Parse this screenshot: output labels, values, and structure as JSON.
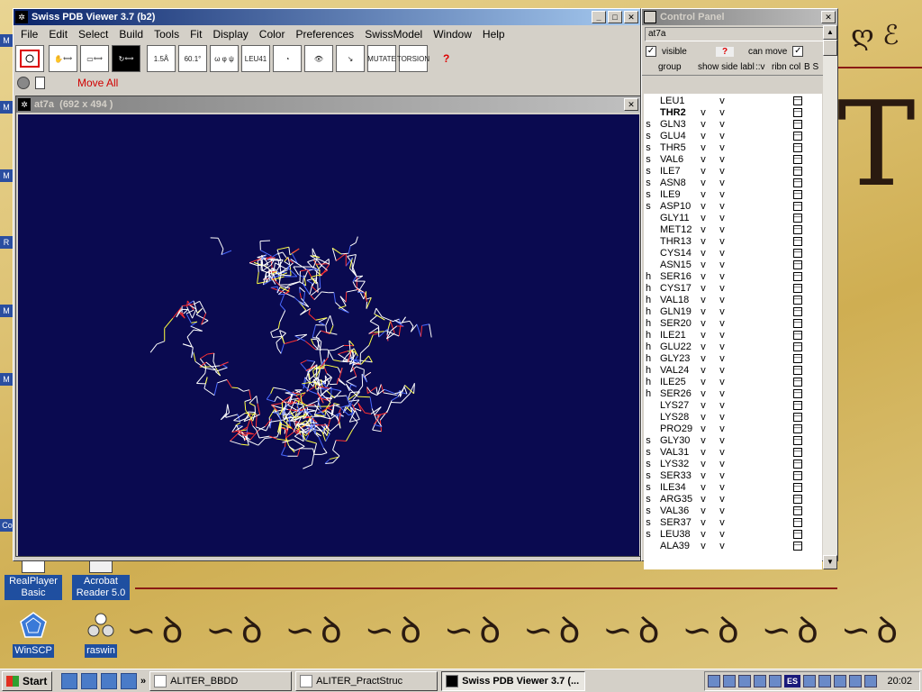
{
  "main_window": {
    "title": "Swiss PDB Viewer 3.7 (b2)",
    "menus": [
      "File",
      "Edit",
      "Select",
      "Build",
      "Tools",
      "Fit",
      "Display",
      "Color",
      "Preferences",
      "SwissModel",
      "Window",
      "Help"
    ],
    "toolbar_labels": {
      "distance": "1.5Å",
      "angle": "60.1°",
      "torsion": "ω φ ψ",
      "find": "LEU41",
      "mutate": "MUTATE",
      "torsion_tool": "TORSION"
    },
    "move_all": "Move All"
  },
  "structure_window": {
    "title": "at7a",
    "size": "(692 x 494 )"
  },
  "control_panel": {
    "title": "Control Panel",
    "field": "at7a",
    "visible_label": "visible",
    "can_move_label": "can move",
    "help": "?",
    "headers": [
      "group",
      "show side labl",
      "::v",
      "ribn col",
      "B S"
    ],
    "residues": [
      {
        "ss": "",
        "name": "LEU1",
        "show": "",
        "side": "v",
        "bold": false
      },
      {
        "ss": "",
        "name": "THR2",
        "show": "v",
        "side": "v",
        "bold": true
      },
      {
        "ss": "s",
        "name": "GLN3",
        "show": "v",
        "side": "v",
        "bold": false
      },
      {
        "ss": "s",
        "name": "GLU4",
        "show": "v",
        "side": "v",
        "bold": false
      },
      {
        "ss": "s",
        "name": "THR5",
        "show": "v",
        "side": "v",
        "bold": false
      },
      {
        "ss": "s",
        "name": "VAL6",
        "show": "v",
        "side": "v",
        "bold": false
      },
      {
        "ss": "s",
        "name": "ILE7",
        "show": "v",
        "side": "v",
        "bold": false
      },
      {
        "ss": "s",
        "name": "ASN8",
        "show": "v",
        "side": "v",
        "bold": false
      },
      {
        "ss": "s",
        "name": "ILE9",
        "show": "v",
        "side": "v",
        "bold": false
      },
      {
        "ss": "s",
        "name": "ASP10",
        "show": "v",
        "side": "v",
        "bold": false
      },
      {
        "ss": "",
        "name": "GLY11",
        "show": "v",
        "side": "v",
        "bold": false
      },
      {
        "ss": "",
        "name": "MET12",
        "show": "v",
        "side": "v",
        "bold": false
      },
      {
        "ss": "",
        "name": "THR13",
        "show": "v",
        "side": "v",
        "bold": false
      },
      {
        "ss": "",
        "name": "CYS14",
        "show": "v",
        "side": "v",
        "bold": false
      },
      {
        "ss": "",
        "name": "ASN15",
        "show": "v",
        "side": "v",
        "bold": false
      },
      {
        "ss": "h",
        "name": "SER16",
        "show": "v",
        "side": "v",
        "bold": false
      },
      {
        "ss": "h",
        "name": "CYS17",
        "show": "v",
        "side": "v",
        "bold": false
      },
      {
        "ss": "h",
        "name": "VAL18",
        "show": "v",
        "side": "v",
        "bold": false
      },
      {
        "ss": "h",
        "name": "GLN19",
        "show": "v",
        "side": "v",
        "bold": false
      },
      {
        "ss": "h",
        "name": "SER20",
        "show": "v",
        "side": "v",
        "bold": false
      },
      {
        "ss": "h",
        "name": "ILE21",
        "show": "v",
        "side": "v",
        "bold": false
      },
      {
        "ss": "h",
        "name": "GLU22",
        "show": "v",
        "side": "v",
        "bold": false
      },
      {
        "ss": "h",
        "name": "GLY23",
        "show": "v",
        "side": "v",
        "bold": false
      },
      {
        "ss": "h",
        "name": "VAL24",
        "show": "v",
        "side": "v",
        "bold": false
      },
      {
        "ss": "h",
        "name": "ILE25",
        "show": "v",
        "side": "v",
        "bold": false
      },
      {
        "ss": "h",
        "name": "SER26",
        "show": "v",
        "side": "v",
        "bold": false
      },
      {
        "ss": "",
        "name": "LYS27",
        "show": "v",
        "side": "v",
        "bold": false
      },
      {
        "ss": "",
        "name": "LYS28",
        "show": "v",
        "side": "v",
        "bold": false
      },
      {
        "ss": "",
        "name": "PRO29",
        "show": "v",
        "side": "v",
        "bold": false
      },
      {
        "ss": "s",
        "name": "GLY30",
        "show": "v",
        "side": "v",
        "bold": false
      },
      {
        "ss": "s",
        "name": "VAL31",
        "show": "v",
        "side": "v",
        "bold": false
      },
      {
        "ss": "s",
        "name": "LYS32",
        "show": "v",
        "side": "v",
        "bold": false
      },
      {
        "ss": "s",
        "name": "SER33",
        "show": "v",
        "side": "v",
        "bold": false
      },
      {
        "ss": "s",
        "name": "ILE34",
        "show": "v",
        "side": "v",
        "bold": false
      },
      {
        "ss": "s",
        "name": "ARG35",
        "show": "v",
        "side": "v",
        "bold": false
      },
      {
        "ss": "s",
        "name": "VAL36",
        "show": "v",
        "side": "v",
        "bold": false
      },
      {
        "ss": "s",
        "name": "SER37",
        "show": "v",
        "side": "v",
        "bold": false
      },
      {
        "ss": "s",
        "name": "LEU38",
        "show": "v",
        "side": "v",
        "bold": false
      },
      {
        "ss": "",
        "name": "ALA39",
        "show": "v",
        "side": "v",
        "bold": false
      }
    ]
  },
  "desktop_icons": [
    {
      "label": "RealPlayer Basic",
      "icon": "realplayer-icon"
    },
    {
      "label": "Acrobat Reader 5.0",
      "icon": "acrobat-icon"
    },
    {
      "label": "WinSCP",
      "icon": "winscp-icon"
    },
    {
      "label": "raswin",
      "icon": "raswin-icon"
    }
  ],
  "left_strip_labels": [
    "M",
    "M",
    "M",
    "R",
    "M",
    "M",
    "Co"
  ],
  "taskbar": {
    "start": "Start",
    "tasks": [
      {
        "label": "ALITER_BBDD",
        "active": false
      },
      {
        "label": "ALITER_PractStruc",
        "active": false
      },
      {
        "label": "Swiss PDB Viewer 3.7 (...",
        "active": true
      }
    ],
    "language": "ES",
    "clock": "20:02"
  },
  "colors": {
    "viewport_bg": "#0a0a50",
    "title_active": "#0a246a",
    "move_all": "#d00000"
  }
}
